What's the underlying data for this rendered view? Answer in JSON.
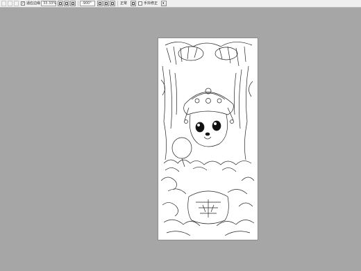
{
  "toolbar": {
    "fit_screen_label": "适应边缘",
    "fit_screen_checked": true,
    "zoom_value": "33.33%",
    "rotation_value": "-900°",
    "blend_mode_label": "正常",
    "hand_correction_label": "手抖修正",
    "hand_correction_checked": false
  },
  "icons": [
    "fit-screen-icon",
    "zoom-in-icon",
    "zoom-out-icon",
    "actual-size-icon",
    "rotate-left-icon",
    "rotate-right-icon",
    "reset-rotation-icon",
    "flip-icon",
    "chevron-down-icon"
  ],
  "canvas": {
    "background": "#ffffff",
    "workspace_color": "#a6a6a6"
  }
}
